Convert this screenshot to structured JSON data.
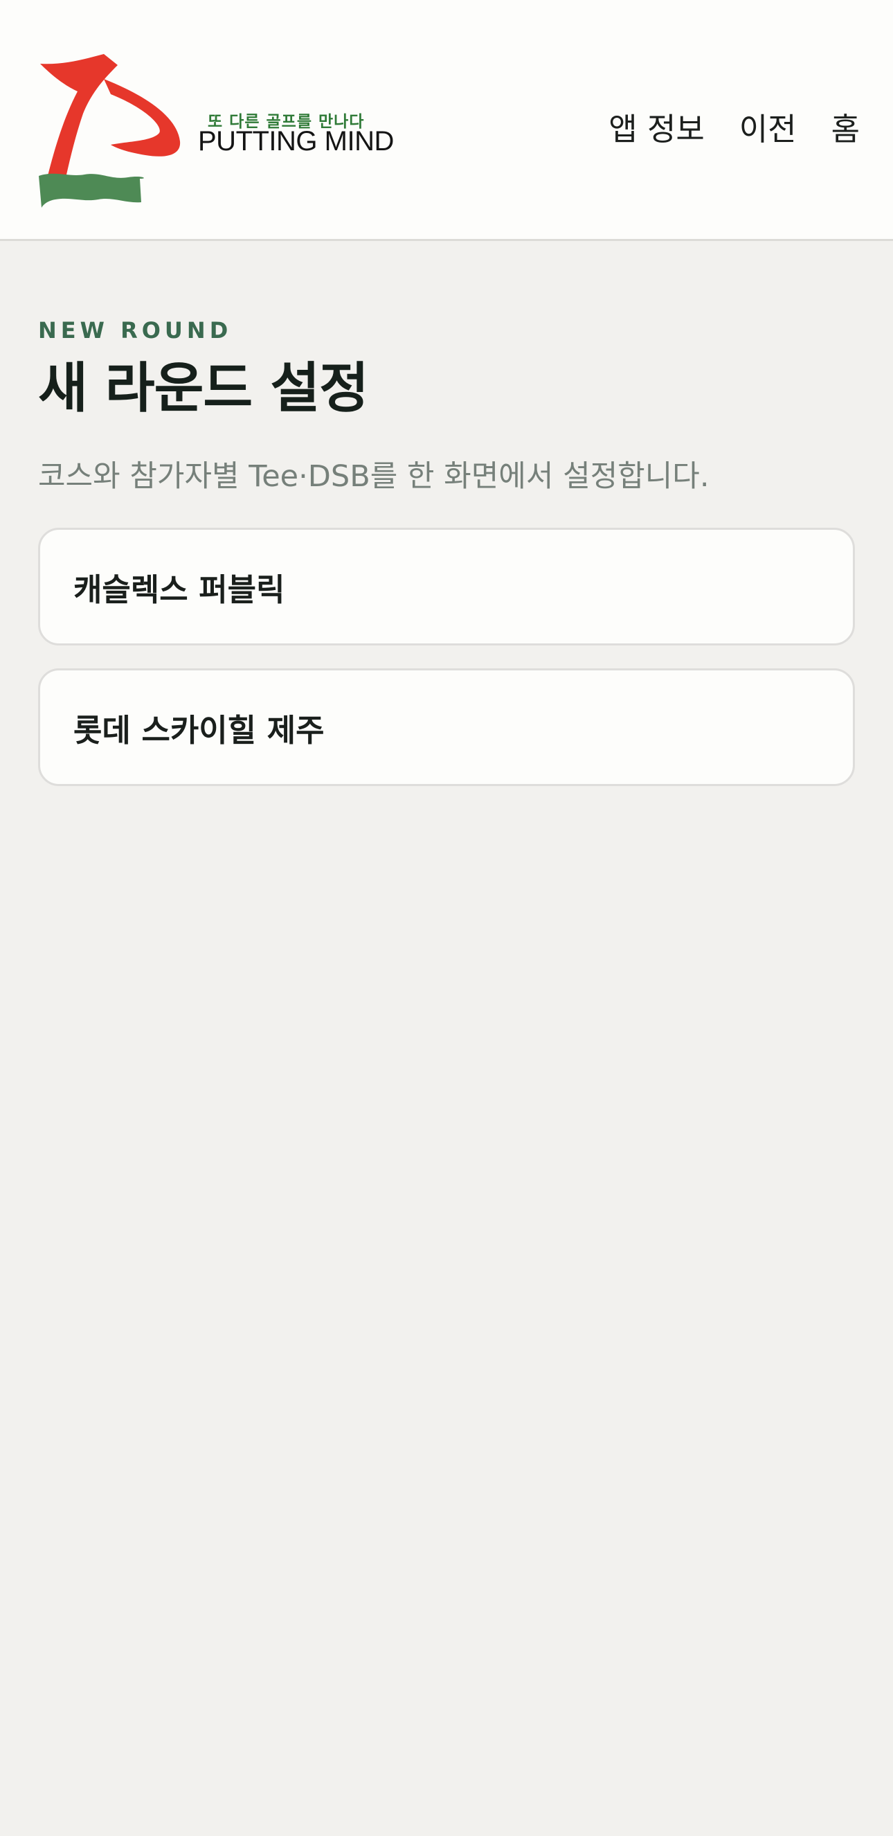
{
  "header": {
    "logo": {
      "tagline": "또 다른 골프를 만나다",
      "wordmark": "PUTTING MIND",
      "colors": {
        "red": "#e6372b",
        "green": "#4e8a55"
      }
    },
    "nav": [
      {
        "label": "앱 정보"
      },
      {
        "label": "이전"
      },
      {
        "label": "홈"
      }
    ]
  },
  "main": {
    "eyebrow": "NEW ROUND",
    "title": "새 라운드 설정",
    "subtitle": "코스와 참가자별 Tee·DSB를 한 화면에서 설정합니다.",
    "courses": [
      {
        "name": "캐슬렉스 퍼블릭"
      },
      {
        "name": "롯데 스카이힐 제주"
      }
    ]
  },
  "theme": {
    "background": "#f2f1ee",
    "surface": "#fdfdfb",
    "accent_green": "#3a6a4f",
    "text_muted": "#76807a"
  }
}
